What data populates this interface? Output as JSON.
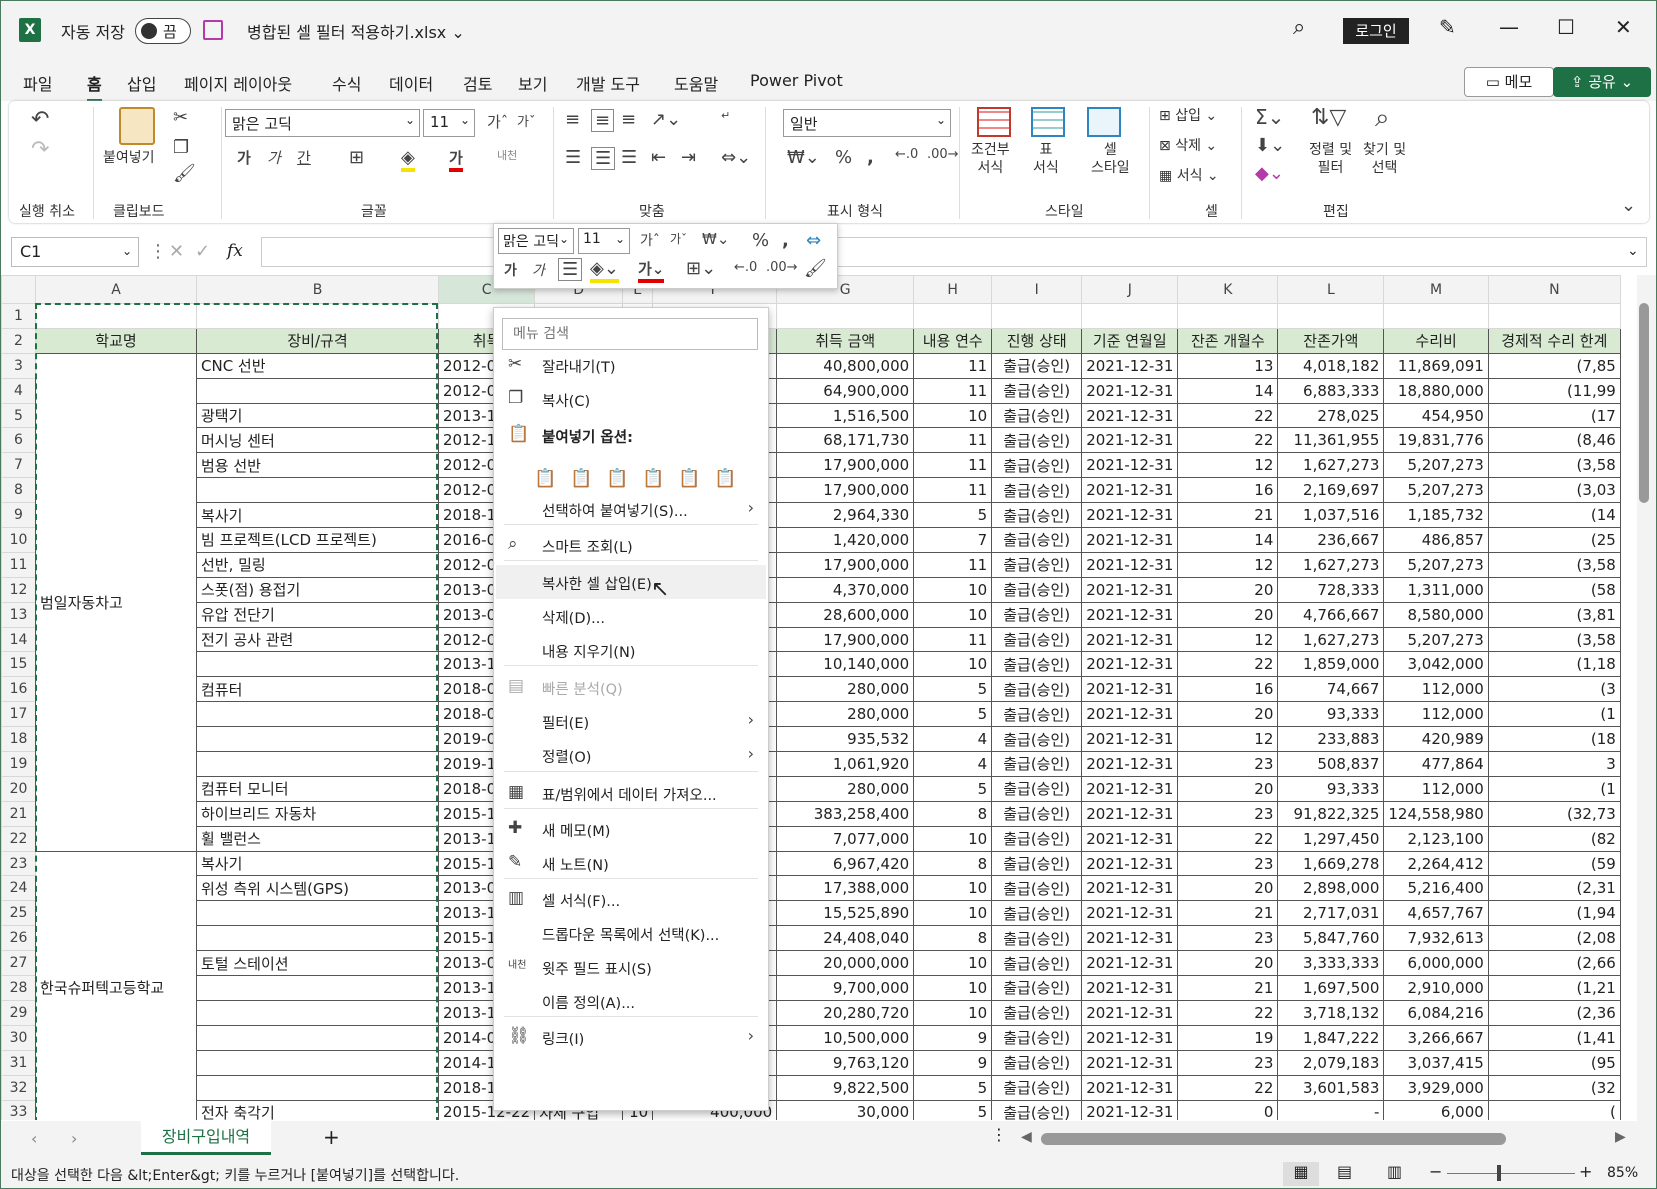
{
  "title_bar": {
    "autosave_label": "자동 저장",
    "autosave_state": "끔",
    "file_name": "병합된 셀 필터 적용하기.xlsx",
    "login_label": "로그인"
  },
  "menu_tabs": [
    "파일",
    "홈",
    "삽입",
    "페이지 레이아웃",
    "수식",
    "데이터",
    "검토",
    "보기",
    "개발 도구",
    "도움말",
    "Power Pivot"
  ],
  "memo_label": "메모",
  "share_label": "공유",
  "ribbon": {
    "groups": [
      "실행 취소",
      "클립보드",
      "글꼴",
      "맞춤",
      "표시 형식",
      "스타일",
      "셀",
      "편집"
    ],
    "paste_label": "붙여넣기",
    "font_name": "맑은 고딕",
    "font_size": "11",
    "number_format": "일반",
    "style_buttons": [
      "조건부\n서식",
      "표\n서식",
      "셀\n스타일"
    ],
    "cell_buttons": [
      "삽입",
      "삭제",
      "서식"
    ],
    "edit_buttons": [
      "정렬 및\n필터",
      "찾기 및\n선택"
    ],
    "wrap_label": "자동\n줄"
  },
  "formula_bar": {
    "name_box": "C1",
    "fx": "fx"
  },
  "columns": [
    "A",
    "B",
    "C",
    "D",
    "E",
    "F",
    "G",
    "H",
    "I",
    "J",
    "K",
    "L",
    "M",
    "N"
  ],
  "header_row": [
    "학교명",
    "장비/규격",
    "취득",
    "",
    "",
    "",
    "취득 금액",
    "내용 연수",
    "진행 상태",
    "기준 연월일",
    "잔존 개월수",
    "잔존가액",
    "수리비",
    "경제적 수리 한계"
  ],
  "merged_schools": [
    {
      "name": "범일자동차고",
      "row": 12
    },
    {
      "name": "한국슈퍼텍고등학교",
      "row": 28
    }
  ],
  "rows": [
    {
      "b": "CNC 선반",
      "c": "2012-0",
      "g": "40,800,000",
      "h": "11",
      "i": "출급(승인)",
      "j": "2021-12-31",
      "k": "13",
      "l": "4,018,182",
      "m": "11,869,091",
      "n": "(7,85"
    },
    {
      "b": "",
      "c": "2012-0",
      "g": "64,900,000",
      "h": "11",
      "i": "출급(승인)",
      "j": "2021-12-31",
      "k": "14",
      "l": "6,883,333",
      "m": "18,880,000",
      "n": "(11,99"
    },
    {
      "b": "광택기",
      "c": "2013-1",
      "g": "1,516,500",
      "h": "10",
      "i": "출급(승인)",
      "j": "2021-12-31",
      "k": "22",
      "l": "278,025",
      "m": "454,950",
      "n": "(17"
    },
    {
      "b": "머시닝 센터",
      "c": "2012-1",
      "g": "68,171,730",
      "h": "11",
      "i": "출급(승인)",
      "j": "2021-12-31",
      "k": "22",
      "l": "11,361,955",
      "m": "19,831,776",
      "n": "(8,46"
    },
    {
      "b": "범용 선반",
      "c": "2012-0",
      "g": "17,900,000",
      "h": "11",
      "i": "출급(승인)",
      "j": "2021-12-31",
      "k": "12",
      "l": "1,627,273",
      "m": "5,207,273",
      "n": "(3,58"
    },
    {
      "b": "",
      "c": "2012-0",
      "g": "17,900,000",
      "h": "11",
      "i": "출급(승인)",
      "j": "2021-12-31",
      "k": "16",
      "l": "2,169,697",
      "m": "5,207,273",
      "n": "(3,03"
    },
    {
      "b": "복사기",
      "c": "2018-1",
      "g": "2,964,330",
      "h": "5",
      "i": "출급(승인)",
      "j": "2021-12-31",
      "k": "21",
      "l": "1,037,516",
      "m": "1,185,732",
      "n": "(14"
    },
    {
      "b": "빔 프로젝트(LCD 프로젝트)",
      "c": "2016-0",
      "g": "1,420,000",
      "h": "7",
      "i": "출급(승인)",
      "j": "2021-12-31",
      "k": "14",
      "l": "236,667",
      "m": "486,857",
      "n": "(25"
    },
    {
      "b": "선반, 밀링",
      "c": "2012-0",
      "g": "17,900,000",
      "h": "11",
      "i": "출급(승인)",
      "j": "2021-12-31",
      "k": "12",
      "l": "1,627,273",
      "m": "5,207,273",
      "n": "(3,58"
    },
    {
      "b": "스폿(점) 용접기",
      "c": "2013-0",
      "g": "4,370,000",
      "h": "10",
      "i": "출급(승인)",
      "j": "2021-12-31",
      "k": "20",
      "l": "728,333",
      "m": "1,311,000",
      "n": "(58"
    },
    {
      "b": "유압 전단기",
      "c": "2013-0",
      "g": "28,600,000",
      "h": "10",
      "i": "출급(승인)",
      "j": "2021-12-31",
      "k": "20",
      "l": "4,766,667",
      "m": "8,580,000",
      "n": "(3,81"
    },
    {
      "b": "전기 공사 관련",
      "c": "2012-0",
      "g": "17,900,000",
      "h": "11",
      "i": "출급(승인)",
      "j": "2021-12-31",
      "k": "12",
      "l": "1,627,273",
      "m": "5,207,273",
      "n": "(3,58"
    },
    {
      "b": "",
      "c": "2013-1",
      "g": "10,140,000",
      "h": "10",
      "i": "출급(승인)",
      "j": "2021-12-31",
      "k": "22",
      "l": "1,859,000",
      "m": "3,042,000",
      "n": "(1,18"
    },
    {
      "b": "컴퓨터",
      "c": "2018-0",
      "g": "280,000",
      "h": "5",
      "i": "출급(승인)",
      "j": "2021-12-31",
      "k": "16",
      "l": "74,667",
      "m": "112,000",
      "n": "(3"
    },
    {
      "b": "",
      "c": "2018-0",
      "g": "280,000",
      "h": "5",
      "i": "출급(승인)",
      "j": "2021-12-31",
      "k": "20",
      "l": "93,333",
      "m": "112,000",
      "n": "(1"
    },
    {
      "b": "",
      "c": "2019-0",
      "g": "935,532",
      "h": "4",
      "i": "출급(승인)",
      "j": "2021-12-31",
      "k": "12",
      "l": "233,883",
      "m": "420,989",
      "n": "(18"
    },
    {
      "b": "",
      "c": "2019-1",
      "g": "1,061,920",
      "h": "4",
      "i": "출급(승인)",
      "j": "2021-12-31",
      "k": "23",
      "l": "508,837",
      "m": "477,864",
      "n": "3"
    },
    {
      "b": "컴퓨터 모니터",
      "c": "2018-0",
      "g": "280,000",
      "h": "5",
      "i": "출급(승인)",
      "j": "2021-12-31",
      "k": "20",
      "l": "93,333",
      "m": "112,000",
      "n": "(1"
    },
    {
      "b": "하이브리드 자동차",
      "c": "2015-1",
      "g": "383,258,400",
      "h": "8",
      "i": "출급(승인)",
      "j": "2021-12-31",
      "k": "23",
      "l": "91,822,325",
      "m": "124,558,980",
      "n": "(32,73"
    },
    {
      "b": "휠 밸런스",
      "c": "2013-1",
      "g": "7,077,000",
      "h": "10",
      "i": "출급(승인)",
      "j": "2021-12-31",
      "k": "22",
      "l": "1,297,450",
      "m": "2,123,100",
      "n": "(82"
    },
    {
      "b": "복사기",
      "c": "2015-1",
      "g": "6,967,420",
      "h": "8",
      "i": "출급(승인)",
      "j": "2021-12-31",
      "k": "23",
      "l": "1,669,278",
      "m": "2,264,412",
      "n": "(59"
    },
    {
      "b": "위성 측위 시스템(GPS)",
      "c": "2013-0",
      "g": "17,388,000",
      "h": "10",
      "i": "출급(승인)",
      "j": "2021-12-31",
      "k": "20",
      "l": "2,898,000",
      "m": "5,216,400",
      "n": "(2,31"
    },
    {
      "b": "",
      "c": "2013-1",
      "g": "15,525,890",
      "h": "10",
      "i": "출급(승인)",
      "j": "2021-12-31",
      "k": "21",
      "l": "2,717,031",
      "m": "4,657,767",
      "n": "(1,94"
    },
    {
      "b": "",
      "c": "2015-1",
      "g": "24,408,040",
      "h": "8",
      "i": "출급(승인)",
      "j": "2021-12-31",
      "k": "23",
      "l": "5,847,760",
      "m": "7,932,613",
      "n": "(2,08"
    },
    {
      "b": "토털 스테이션",
      "c": "2013-0",
      "g": "20,000,000",
      "h": "10",
      "i": "출급(승인)",
      "j": "2021-12-31",
      "k": "20",
      "l": "3,333,333",
      "m": "6,000,000",
      "n": "(2,66"
    },
    {
      "b": "",
      "c": "2013-1",
      "g": "9,700,000",
      "h": "10",
      "i": "출급(승인)",
      "j": "2021-12-31",
      "k": "21",
      "l": "1,697,500",
      "m": "2,910,000",
      "n": "(1,21"
    },
    {
      "b": "",
      "c": "2013-1",
      "g": "20,280,720",
      "h": "10",
      "i": "출급(승인)",
      "j": "2021-12-31",
      "k": "22",
      "l": "3,718,132",
      "m": "6,084,216",
      "n": "(2,36"
    },
    {
      "b": "",
      "c": "2014-0",
      "g": "10,500,000",
      "h": "9",
      "i": "출급(승인)",
      "j": "2021-12-31",
      "k": "19",
      "l": "1,847,222",
      "m": "3,266,667",
      "n": "(1,41"
    },
    {
      "b": "",
      "c": "2014-1",
      "g": "9,763,120",
      "h": "9",
      "i": "출급(승인)",
      "j": "2021-12-31",
      "k": "23",
      "l": "2,079,183",
      "m": "3,037,415",
      "n": "(95"
    },
    {
      "b": "",
      "c": "2018-1",
      "g": "9,822,500",
      "h": "5",
      "i": "출급(승인)",
      "j": "2021-12-31",
      "k": "22",
      "l": "3,601,583",
      "m": "3,929,000",
      "n": "(32"
    },
    {
      "b": "전자 축각기",
      "c": "2015-12-22",
      "d": "자체 구입",
      "e": "10",
      "f": "400,000",
      "g": "30,000",
      "h": "5",
      "i": "출급(승인)",
      "j": "2021-12-31",
      "k": "0",
      "l": "-",
      "m": "6,000",
      "n": "("
    }
  ],
  "mini_toolbar": {
    "font": "맑은 고딕",
    "size": "11"
  },
  "context_menu": {
    "search_placeholder": "메뉴 검색",
    "items": [
      {
        "label": "잘라내기(T)",
        "icon": "scissors-icon",
        "glyph": "✂"
      },
      {
        "label": "복사(C)",
        "icon": "copy-icon",
        "glyph": "❐"
      },
      {
        "label": "붙여넣기 옵션:",
        "icon": "paste-icon",
        "glyph": "📋",
        "bold": true
      },
      {
        "label": "선택하여 붙여넣기(S)...",
        "sub": true
      },
      {
        "label": "스마트 조회(L)",
        "icon": "smart-lookup-icon",
        "glyph": "⌕"
      },
      {
        "label": "복사한 셀 삽입(E)",
        "hover": true
      },
      {
        "label": "삭제(D)..."
      },
      {
        "label": "내용 지우기(N)"
      },
      {
        "label": "빠른 분석(Q)",
        "icon": "quick-analysis-icon",
        "glyph": "▤",
        "disabled": true
      },
      {
        "label": "필터(E)",
        "sub": true
      },
      {
        "label": "정렬(O)",
        "sub": true
      },
      {
        "label": "표/범위에서 데이터 가져오...",
        "icon": "table-icon",
        "glyph": "▦"
      },
      {
        "label": "새 메모(M)",
        "icon": "new-comment-icon",
        "glyph": "✚"
      },
      {
        "label": "새 노트(N)",
        "icon": "new-note-icon",
        "glyph": "✎"
      },
      {
        "label": "셀 서식(F)...",
        "icon": "format-cells-icon",
        "glyph": "▥"
      },
      {
        "label": "드롭다운 목록에서 선택(K)..."
      },
      {
        "label": "윗주 필드 표시(S)",
        "icon": "phonetic-icon",
        "glyph": "내천"
      },
      {
        "label": "이름 정의(A)..."
      },
      {
        "label": "링크(I)",
        "icon": "link-icon",
        "glyph": "⛓",
        "sub": true
      }
    ]
  },
  "sheet_tab": "장비구입내역",
  "status_text": "대상을 선택한 다음 &lt;Enter&gt; 키를 누르거나 [붙여넣기]를 선택합니다.",
  "zoom": "85%",
  "colors": {
    "accent": "#1e7145",
    "header_fill": "#d9ead3"
  }
}
